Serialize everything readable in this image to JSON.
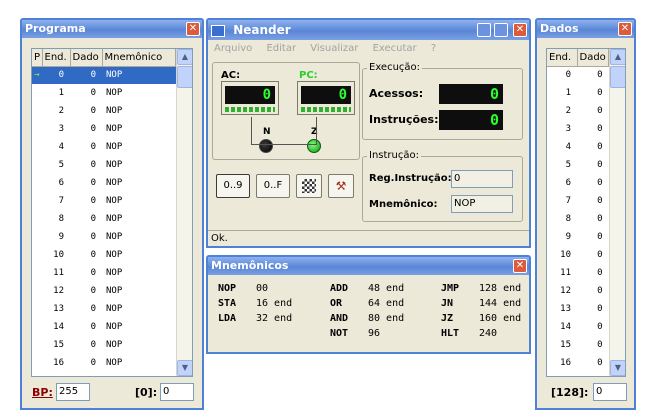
{
  "programa": {
    "title": "Programa",
    "close": "✕",
    "columns": [
      "P",
      "End.",
      "Dado",
      "Mnemônico"
    ],
    "rows": [
      {
        "p": "→",
        "addr": "0",
        "val": "0",
        "mn": "NOP"
      },
      {
        "p": "",
        "addr": "1",
        "val": "0",
        "mn": "NOP"
      },
      {
        "p": "",
        "addr": "2",
        "val": "0",
        "mn": "NOP"
      },
      {
        "p": "",
        "addr": "3",
        "val": "0",
        "mn": "NOP"
      },
      {
        "p": "",
        "addr": "4",
        "val": "0",
        "mn": "NOP"
      },
      {
        "p": "",
        "addr": "5",
        "val": "0",
        "mn": "NOP"
      },
      {
        "p": "",
        "addr": "6",
        "val": "0",
        "mn": "NOP"
      },
      {
        "p": "",
        "addr": "7",
        "val": "0",
        "mn": "NOP"
      },
      {
        "p": "",
        "addr": "8",
        "val": "0",
        "mn": "NOP"
      },
      {
        "p": "",
        "addr": "9",
        "val": "0",
        "mn": "NOP"
      },
      {
        "p": "",
        "addr": "10",
        "val": "0",
        "mn": "NOP"
      },
      {
        "p": "",
        "addr": "11",
        "val": "0",
        "mn": "NOP"
      },
      {
        "p": "",
        "addr": "12",
        "val": "0",
        "mn": "NOP"
      },
      {
        "p": "",
        "addr": "13",
        "val": "0",
        "mn": "NOP"
      },
      {
        "p": "",
        "addr": "14",
        "val": "0",
        "mn": "NOP"
      },
      {
        "p": "",
        "addr": "15",
        "val": "0",
        "mn": "NOP"
      },
      {
        "p": "",
        "addr": "16",
        "val": "0",
        "mn": "NOP"
      }
    ],
    "bp_label": "BP:",
    "bp_value": "255",
    "addr_label": "[0]:",
    "addr_value": "0"
  },
  "neander": {
    "title": "Neander",
    "menu": [
      "Arquivo",
      "Editar",
      "Visualizar",
      "Executar",
      "?"
    ],
    "ac_label": "AC:",
    "ac_value": "0",
    "pc_label": "PC:",
    "pc_value": "0",
    "n_label": "N",
    "z_label": "Z",
    "execucao_label": "Execução:",
    "acessos_label": "Acessos:",
    "acessos_value": "0",
    "instrucoes_label": "Instruções:",
    "instrucoes_value": "0",
    "instrucao_label": "Instrução:",
    "reg_label": "Reg.Instrução:",
    "reg_value": "0",
    "mnemonico_label": "Mnemônico:",
    "mnemonico_value": "NOP",
    "btn_dec": "0..9",
    "btn_hex": "0..F",
    "status": "Ok."
  },
  "mnemonicos": {
    "title": "Mnemônicos",
    "close": "✕",
    "col1": [
      {
        "op": "NOP",
        "arg": "00"
      },
      {
        "op": "STA",
        "arg": "16 end"
      },
      {
        "op": "LDA",
        "arg": "32 end"
      }
    ],
    "col2": [
      {
        "op": "ADD",
        "arg": "48 end"
      },
      {
        "op": "OR",
        "arg": "64 end"
      },
      {
        "op": "AND",
        "arg": "80 end"
      },
      {
        "op": "NOT",
        "arg": "96"
      }
    ],
    "col3": [
      {
        "op": "JMP",
        "arg": "128 end"
      },
      {
        "op": "JN",
        "arg": "144 end"
      },
      {
        "op": "JZ",
        "arg": "160 end"
      },
      {
        "op": "HLT",
        "arg": "240"
      }
    ]
  },
  "dados": {
    "title": "Dados",
    "close": "✕",
    "columns": [
      "End.",
      "Dado"
    ],
    "rows": [
      {
        "addr": "0",
        "val": "0"
      },
      {
        "addr": "1",
        "val": "0"
      },
      {
        "addr": "2",
        "val": "0"
      },
      {
        "addr": "3",
        "val": "0"
      },
      {
        "addr": "4",
        "val": "0"
      },
      {
        "addr": "5",
        "val": "0"
      },
      {
        "addr": "6",
        "val": "0"
      },
      {
        "addr": "7",
        "val": "0"
      },
      {
        "addr": "8",
        "val": "0"
      },
      {
        "addr": "9",
        "val": "0"
      },
      {
        "addr": "10",
        "val": "0"
      },
      {
        "addr": "11",
        "val": "0"
      },
      {
        "addr": "12",
        "val": "0"
      },
      {
        "addr": "13",
        "val": "0"
      },
      {
        "addr": "14",
        "val": "0"
      },
      {
        "addr": "15",
        "val": "0"
      },
      {
        "addr": "16",
        "val": "0"
      }
    ],
    "addr_label": "[128]:",
    "addr_value": "0"
  },
  "colors": {
    "title_blue": "#5a86d6",
    "lcd_green": "#2bff2b",
    "selection": "#316ac5",
    "bp_red": "#8b0000"
  }
}
